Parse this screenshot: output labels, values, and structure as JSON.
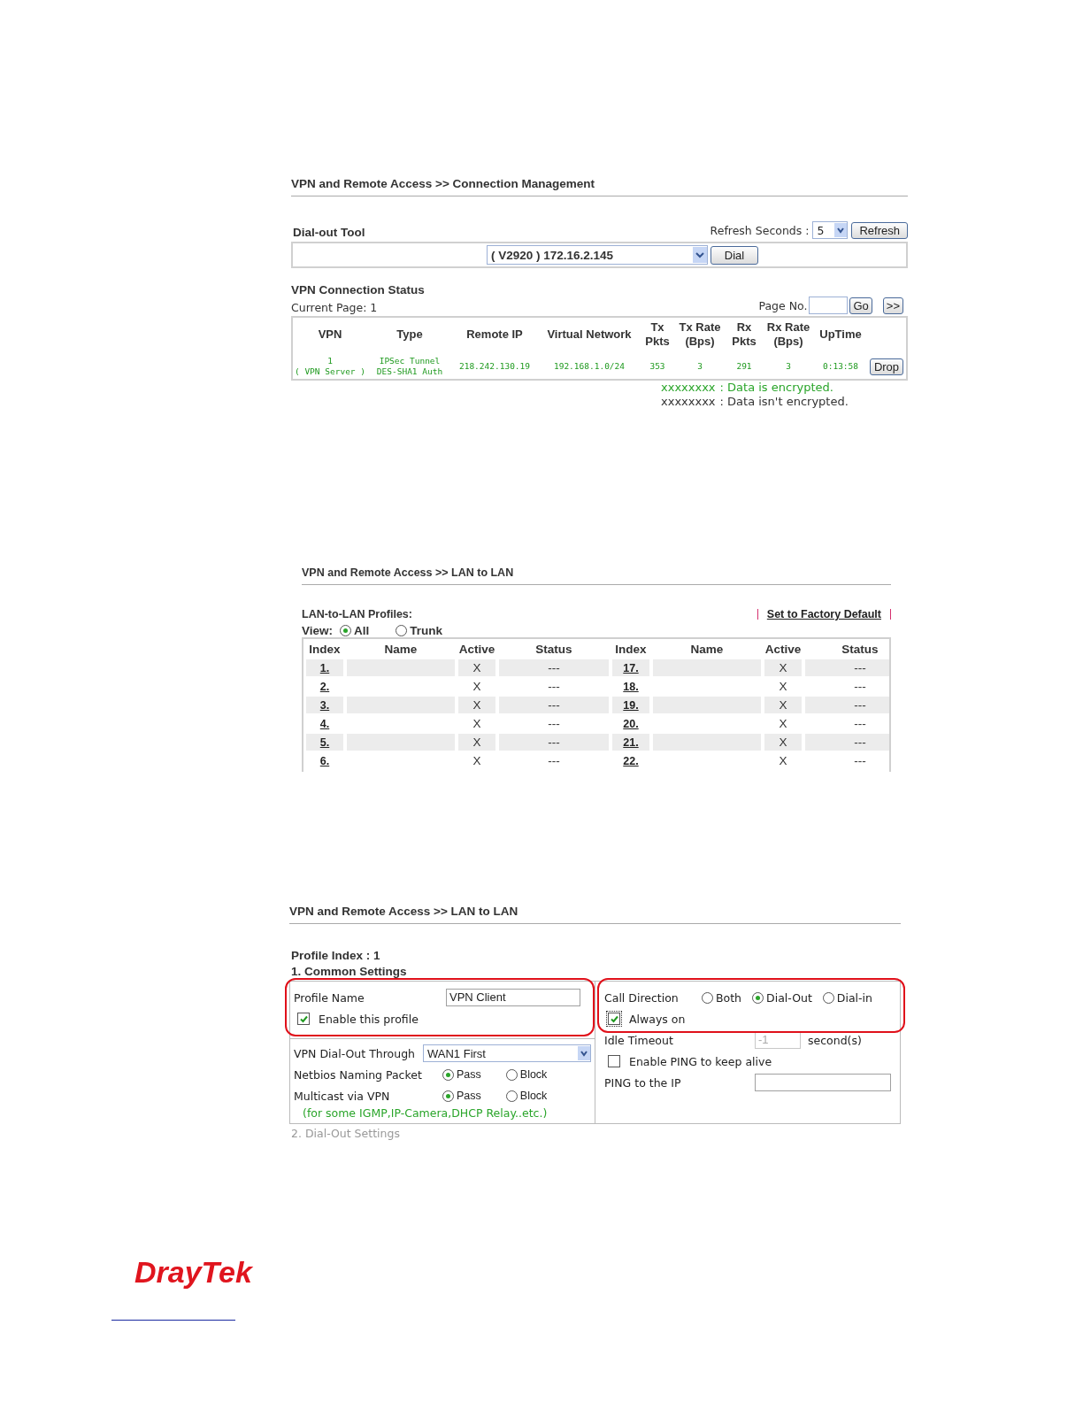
{
  "connection_management": {
    "breadcrumb": "VPN and Remote Access >> Connection Management",
    "dialout": {
      "title": "Dial-out Tool",
      "refresh_label": "Refresh Seconds :",
      "refresh_value": "5",
      "refresh_button": "Refresh",
      "profile_value": "( V2920 ) 172.16.2.145",
      "dial_button": "Dial"
    },
    "status": {
      "title": "VPN Connection Status",
      "current_page": "Current Page: 1",
      "page_no_label": "Page No.",
      "go_button": "Go",
      "next_button": ">>",
      "columns": [
        "VPN",
        "Type",
        "Remote IP",
        "Virtual Network",
        "Tx Pkts",
        "Tx Rate (Bps)",
        "Rx Pkts",
        "Rx Rate (Bps)",
        "UpTime"
      ],
      "rows": [
        {
          "cells": [
            [
              "1",
              "( VPN Server )"
            ],
            [
              "IPSec Tunnel",
              "DES-SHA1 Auth"
            ],
            [
              "218.242.130.19"
            ],
            [
              "192.168.1.0/24"
            ],
            [
              "353"
            ],
            [
              "3"
            ],
            [
              "291"
            ],
            [
              "3"
            ],
            [
              "0:13:58"
            ]
          ],
          "action": "Drop"
        }
      ]
    },
    "legend": [
      {
        "sample": "xxxxxxxx",
        "text": ": Data is encrypted.",
        "encrypted": true
      },
      {
        "sample": "xxxxxxxx",
        "text": ": Data isn't encrypted.",
        "encrypted": false
      }
    ]
  },
  "lan_to_lan_list": {
    "breadcrumb": "VPN and Remote Access >> LAN to LAN",
    "profiles_label": "LAN-to-LAN Profiles:",
    "factory_default_link": "Set to Factory Default",
    "view_label": "View:",
    "view_options": [
      {
        "label": "All",
        "selected": true
      },
      {
        "label": "Trunk",
        "selected": false
      }
    ],
    "columns": [
      "Index",
      "Name",
      "Active",
      "Status",
      "Index",
      "Name",
      "Active",
      "Status"
    ],
    "rows": [
      [
        "1.",
        null,
        "X",
        "---",
        "17.",
        null,
        "X",
        "---"
      ],
      [
        "2.",
        null,
        "X",
        "---",
        "18.",
        null,
        "X",
        "---"
      ],
      [
        "3.",
        null,
        "X",
        "---",
        "19.",
        null,
        "X",
        "---"
      ],
      [
        "4.",
        null,
        "X",
        "---",
        "20.",
        null,
        "X",
        "---"
      ],
      [
        "5.",
        null,
        "X",
        "---",
        "21.",
        null,
        "X",
        "---"
      ],
      [
        "6.",
        null,
        "X",
        "---",
        "22.",
        null,
        "X",
        "---"
      ]
    ]
  },
  "lan_to_lan_profile": {
    "breadcrumb": "VPN and Remote Access >> LAN to LAN",
    "profile_index": "Profile Index : 1",
    "section_title": "1. Common Settings",
    "profile_name": {
      "label": "Profile Name",
      "value": "VPN Client"
    },
    "enable_profile": {
      "label": "Enable this profile",
      "checked": true
    },
    "dialout_through": {
      "label": "VPN Dial-Out Through",
      "value": "WAN1 First"
    },
    "netbios": {
      "label": "Netbios Naming Packet",
      "options": [
        {
          "label": "Pass",
          "selected": true
        },
        {
          "label": "Block",
          "selected": false
        }
      ]
    },
    "multicast": {
      "label": "Multicast via VPN",
      "options": [
        {
          "label": "Pass",
          "selected": true
        },
        {
          "label": "Block",
          "selected": false
        }
      ]
    },
    "multicast_note": "(for some IGMP,IP-Camera,DHCP Relay..etc.)",
    "call_direction": {
      "label": "Call Direction",
      "options": [
        {
          "label": "Both",
          "selected": false
        },
        {
          "label": "Dial-Out",
          "selected": true
        },
        {
          "label": "Dial-in",
          "selected": false
        }
      ]
    },
    "always_on": {
      "label": "Always on",
      "checked": true
    },
    "idle_timeout": {
      "label": "Idle Timeout",
      "value": "-1",
      "unit": "second(s)",
      "disabled": true
    },
    "ping_alive": {
      "label": "Enable PING to keep alive",
      "checked": false
    },
    "ping_ip": {
      "label": "PING to the IP"
    },
    "next_section": "2. Dial-Out Settings"
  },
  "footer": {
    "logo": "DrayTek"
  }
}
